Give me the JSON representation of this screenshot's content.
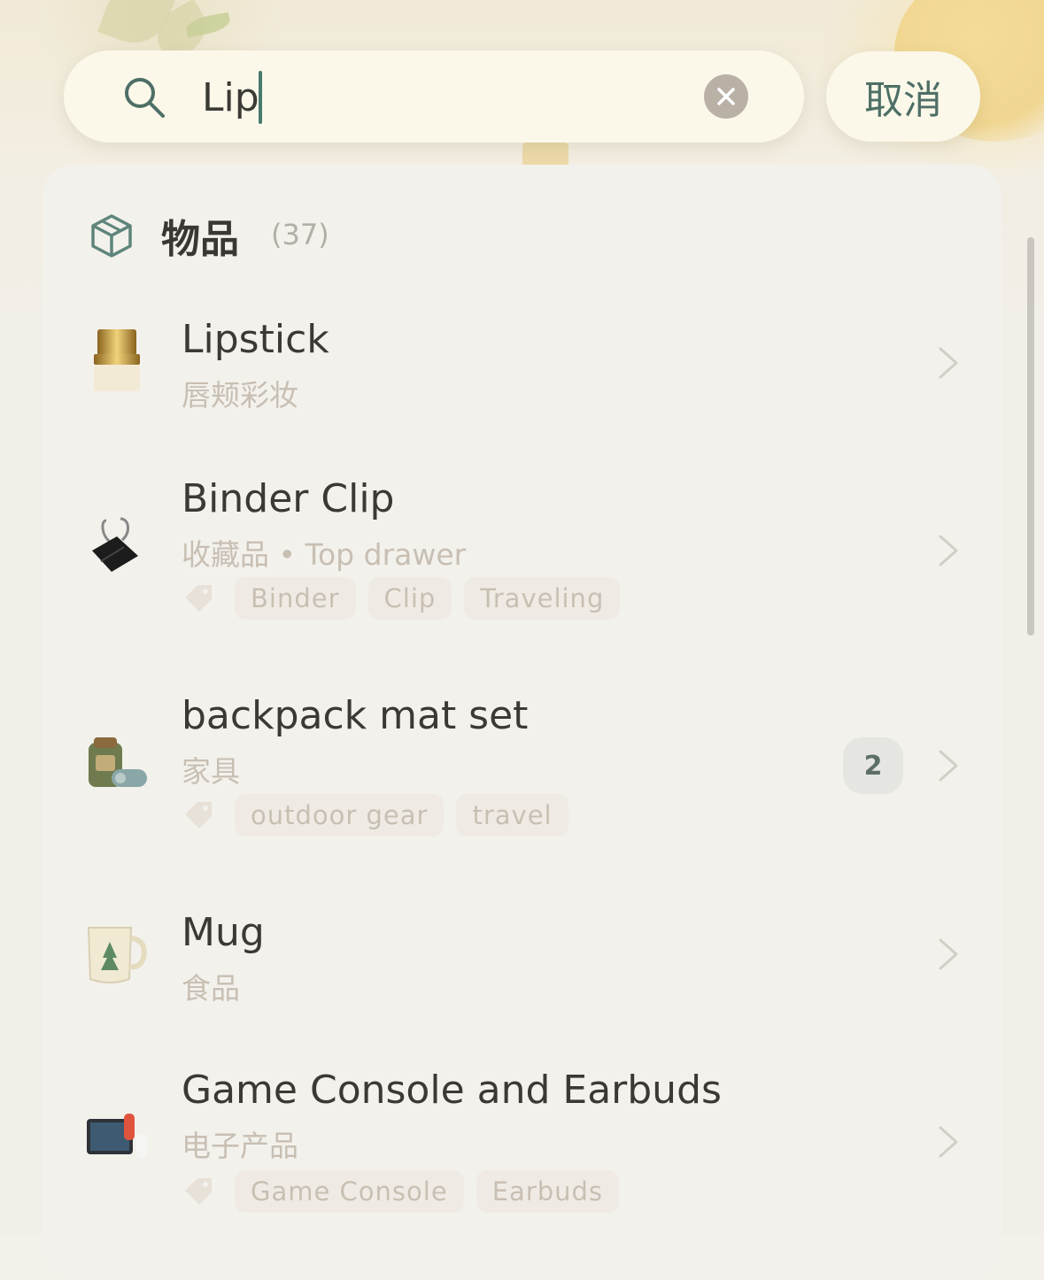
{
  "search": {
    "value": "Lip",
    "cancel_label": "取消"
  },
  "section": {
    "title": "物品",
    "count": "(37)"
  },
  "items": [
    {
      "title": "Lipstick",
      "subtitle": "唇颊彩妆",
      "icon": "lipstick-icon",
      "tags": []
    },
    {
      "title": "Binder Clip",
      "subtitle": "收藏品 • Top drawer",
      "icon": "binder-clip-icon",
      "tags": [
        "Binder",
        "Clip",
        "Traveling"
      ]
    },
    {
      "title": "backpack mat set",
      "subtitle": "家具",
      "icon": "backpack-icon",
      "tags": [
        "outdoor gear",
        "travel"
      ],
      "badge": "2"
    },
    {
      "title": "Mug",
      "subtitle": "食品",
      "icon": "mug-icon",
      "tags": []
    },
    {
      "title": "Game Console and Earbuds",
      "subtitle": "电子产品",
      "icon": "game-console-icon",
      "tags": [
        "Game Console",
        "Earbuds"
      ]
    }
  ],
  "colors": {
    "accent": "#4a7a6e",
    "background": "#f3f1ec",
    "muted_text": "#c8bfb3",
    "title_text": "#3b3934"
  }
}
